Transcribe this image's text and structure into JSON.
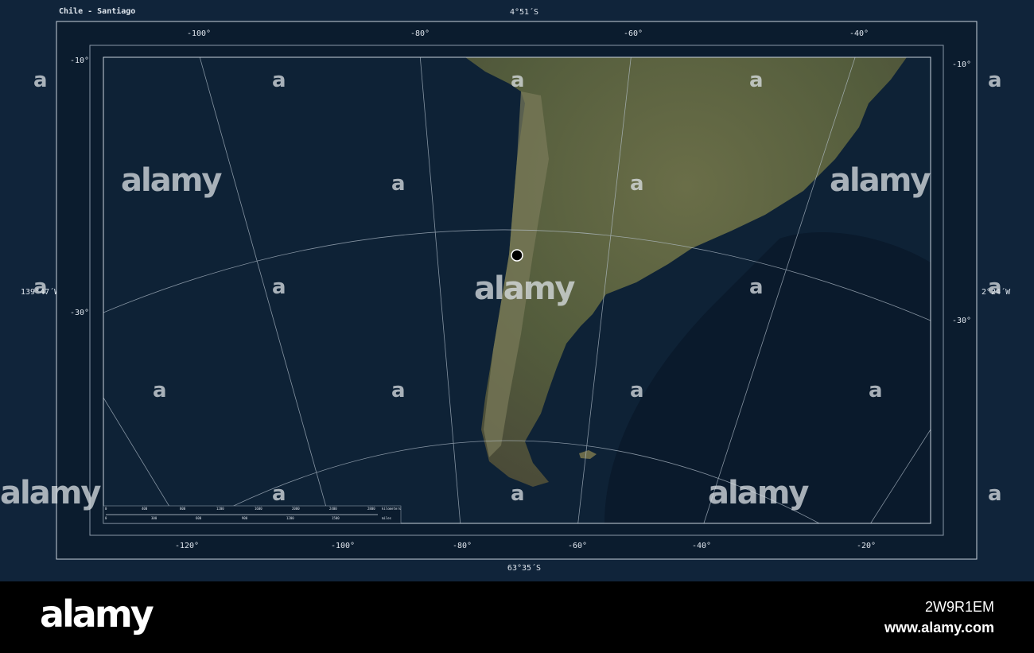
{
  "title": "Chile - Santiago",
  "extent": {
    "north": "4°51´S",
    "south": "63°35´S",
    "west": "139°47´W",
    "east": "2°24´W"
  },
  "graticule": {
    "top_longitudes": [
      "-100°",
      "-80°",
      "-60°",
      "-40°"
    ],
    "bottom_longitudes": [
      "-120°",
      "-100°",
      "-80°",
      "-60°",
      "-40°",
      "-20°"
    ],
    "left_latitudes": [
      "-10°",
      "-30°"
    ],
    "right_latitudes": [
      "-10°",
      "-30°"
    ]
  },
  "marker": {
    "name": "Santiago",
    "color": "#000000"
  },
  "scale_bar": {
    "km_ticks": [
      "0",
      "400",
      "800",
      "1200",
      "1600",
      "2000",
      "2400",
      "2800"
    ],
    "km_unit": "kilometers",
    "mi_ticks": [
      "0",
      "300",
      "600",
      "900",
      "1200",
      "1500"
    ],
    "mi_unit": "miles"
  },
  "watermark": "alamy",
  "banner": {
    "logo": "alamy",
    "image_id": "2W9R1EM",
    "site": "www.alamy.com"
  },
  "colors": {
    "background": "#10243a",
    "ocean": "#0e2236",
    "land": "#56613f"
  }
}
